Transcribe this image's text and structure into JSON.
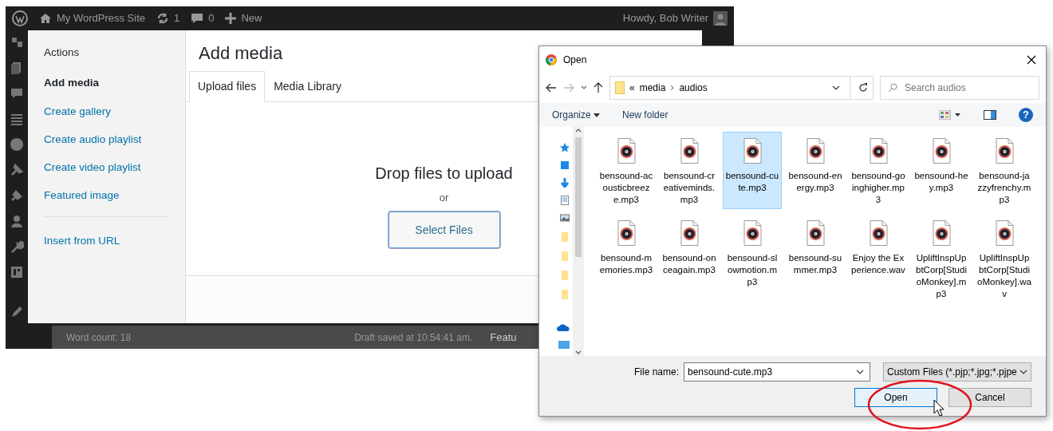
{
  "admin_bar": {
    "site": "My WordPress Site",
    "updates": "1",
    "comments": "0",
    "new": "New",
    "greeting": "Howdy, Bob Writer"
  },
  "media_modal": {
    "menu_heading": "Actions",
    "menu_groups": [
      [
        {
          "label": "Add media",
          "selected": true
        },
        {
          "label": "Create gallery",
          "selected": false
        },
        {
          "label": "Create audio playlist",
          "selected": false
        },
        {
          "label": "Create video playlist",
          "selected": false
        },
        {
          "label": "Featured image",
          "selected": false
        }
      ],
      [
        {
          "label": "Insert from URL",
          "selected": false
        }
      ]
    ],
    "title": "Add media",
    "tabs": [
      {
        "label": "Upload files",
        "selected": true
      },
      {
        "label": "Media Library",
        "selected": false
      }
    ],
    "drop_text": "Drop files to upload",
    "or_text": "or",
    "select_button": "Select Files"
  },
  "editor_footer": {
    "word_count": "Word count: 18",
    "draft_status": "Draft saved at 10:54:41 am.",
    "panel_tab": "Featu"
  },
  "open_dialog": {
    "title": "Open",
    "path_prefix": "«",
    "path": [
      "media",
      "audios"
    ],
    "search_placeholder": "Search audios",
    "organize": "Organize",
    "new_folder": "New folder",
    "help": "?",
    "files": [
      {
        "name": "bensound-acousticbreeze.mp3",
        "selected": false
      },
      {
        "name": "bensound-creativeminds.mp3",
        "selected": false
      },
      {
        "name": "bensound-cute.mp3",
        "selected": true
      },
      {
        "name": "bensound-energy.mp3",
        "selected": false
      },
      {
        "name": "bensound-goinghigher.mp3",
        "selected": false
      },
      {
        "name": "bensound-hey.mp3",
        "selected": false
      },
      {
        "name": "bensound-jazzyfrenchy.mp3",
        "selected": false
      },
      {
        "name": "bensound-memories.mp3",
        "selected": false
      },
      {
        "name": "bensound-onceagain.mp3",
        "selected": false
      },
      {
        "name": "bensound-slowmotion.mp3",
        "selected": false
      },
      {
        "name": "bensound-summer.mp3",
        "selected": false
      },
      {
        "name": "Enjoy the Experience.wav",
        "selected": false
      },
      {
        "name": "UpliftInspUpbtCorp[StudioMonkey].mp3",
        "selected": false
      },
      {
        "name": "UpliftInspUpbtCorp[StudioMonkey].wav",
        "selected": false
      }
    ],
    "file_name_label": "File name:",
    "file_name": "bensound-cute.mp3",
    "filter": "Custom Files (*.pjp;*.jpg;*.pjpe",
    "buttons": [
      {
        "label": "Open",
        "kind": "primary"
      },
      {
        "label": "Cancel",
        "kind": "secondary"
      }
    ]
  }
}
